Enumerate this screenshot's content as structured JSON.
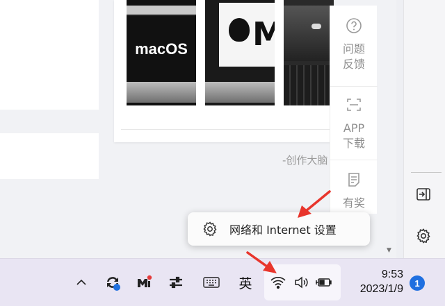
{
  "page": {
    "thumbnails": [
      {
        "text": "macOS"
      },
      {
        "text": "M"
      },
      {
        "text": ""
      }
    ],
    "caption": "-创作大脑"
  },
  "float_panel": {
    "items": [
      {
        "label_line1": "问题",
        "label_line2": "反馈",
        "icon": "question-circle-icon"
      },
      {
        "label_line1": "APP",
        "label_line2": "下载",
        "icon": "scan-icon"
      },
      {
        "label_line1": "有奖",
        "label_line2": "",
        "icon": "document-icon"
      }
    ]
  },
  "tooltip": {
    "label": "网络和 Internet 设置",
    "icon": "gear-icon"
  },
  "right_strip": {
    "icons": [
      "sidebar-collapse-icon",
      "gear-icon"
    ]
  },
  "taskbar": {
    "ime_label": "英",
    "time": "9:53",
    "date": "2023/1/9",
    "notification_count": "1",
    "icons": [
      "chevron-up-icon",
      "sync-icon",
      "mi-app-icon",
      "sliders-icon",
      "keyboard-icon",
      "wifi-icon",
      "volume-icon",
      "battery-charging-icon"
    ]
  },
  "colors": {
    "annotation_arrow": "#e8352c",
    "badge": "#1f6fe0",
    "taskbar": "#e9e5f3"
  }
}
